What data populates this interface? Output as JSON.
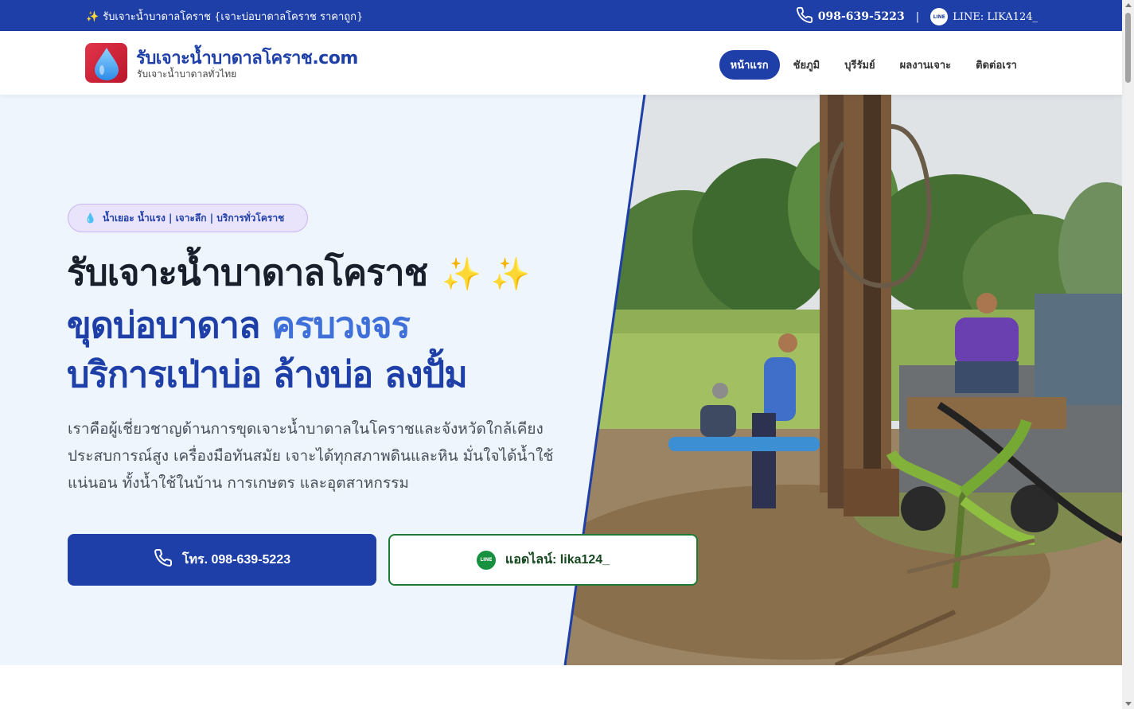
{
  "topbar": {
    "spark_icon": "✨",
    "promo": "รับเจาะน้ำบาดาลโคราช {เจาะบ่อบาดาลโคราช ราคาถูก}",
    "phone": "098-639-5223",
    "separator": "|",
    "line_badge": "LINE",
    "line_label": "LINE: LIKA124_"
  },
  "header": {
    "brand": "รับเจาะน้ำบาดาลโคราช.com",
    "tagline": "รับเจาะน้ำบาดาลทั่วไทย",
    "nav": [
      {
        "label": "หน้าแรก",
        "active": true
      },
      {
        "label": "ชัยภูมิ",
        "active": false
      },
      {
        "label": "บุรีรัมย์",
        "active": false
      },
      {
        "label": "ผลงานเจาะ",
        "active": false
      },
      {
        "label": "ติดต่อเรา",
        "active": false
      }
    ]
  },
  "hero": {
    "pill_icon": "💧",
    "pill": "น้ำเยอะ น้ำแรง | เจาะลึก | บริการทั่วโคราช",
    "line1": "รับเจาะน้ำบาดาลโคราช",
    "sparkles": "✨ ✨",
    "line2_a": "ขุดบ่อบาดาล",
    "line2_b": "ครบวงจร",
    "line3": "บริการเป่าบ่อ ล้างบ่อ ลงปั้ม",
    "description": "เราคือผู้เชี่ยวชาญด้านการขุดเจาะน้ำบาดาลในโคราชและจังหวัดใกล้เคียง ประสบการณ์สูง เครื่องมือทันสมัย เจาะได้ทุกสภาพดินและหิน มั่นใจได้น้ำใช้แน่นอน ทั้งน้ำใช้ในบ้าน การเกษตร และอุตสาหกรรม",
    "call_button": "โทร. 098-639-5223",
    "line_button": "แอดไลน์: lika124_",
    "line_badge": "LINE"
  },
  "colors": {
    "primary": "#1e3fa8",
    "accent": "#3f6fd8",
    "line_green": "#17913f",
    "hero_bg": "#eef5fd"
  },
  "icons": {
    "phone": "phone-icon",
    "line": "line-icon",
    "logo": "water-drop-icon"
  }
}
